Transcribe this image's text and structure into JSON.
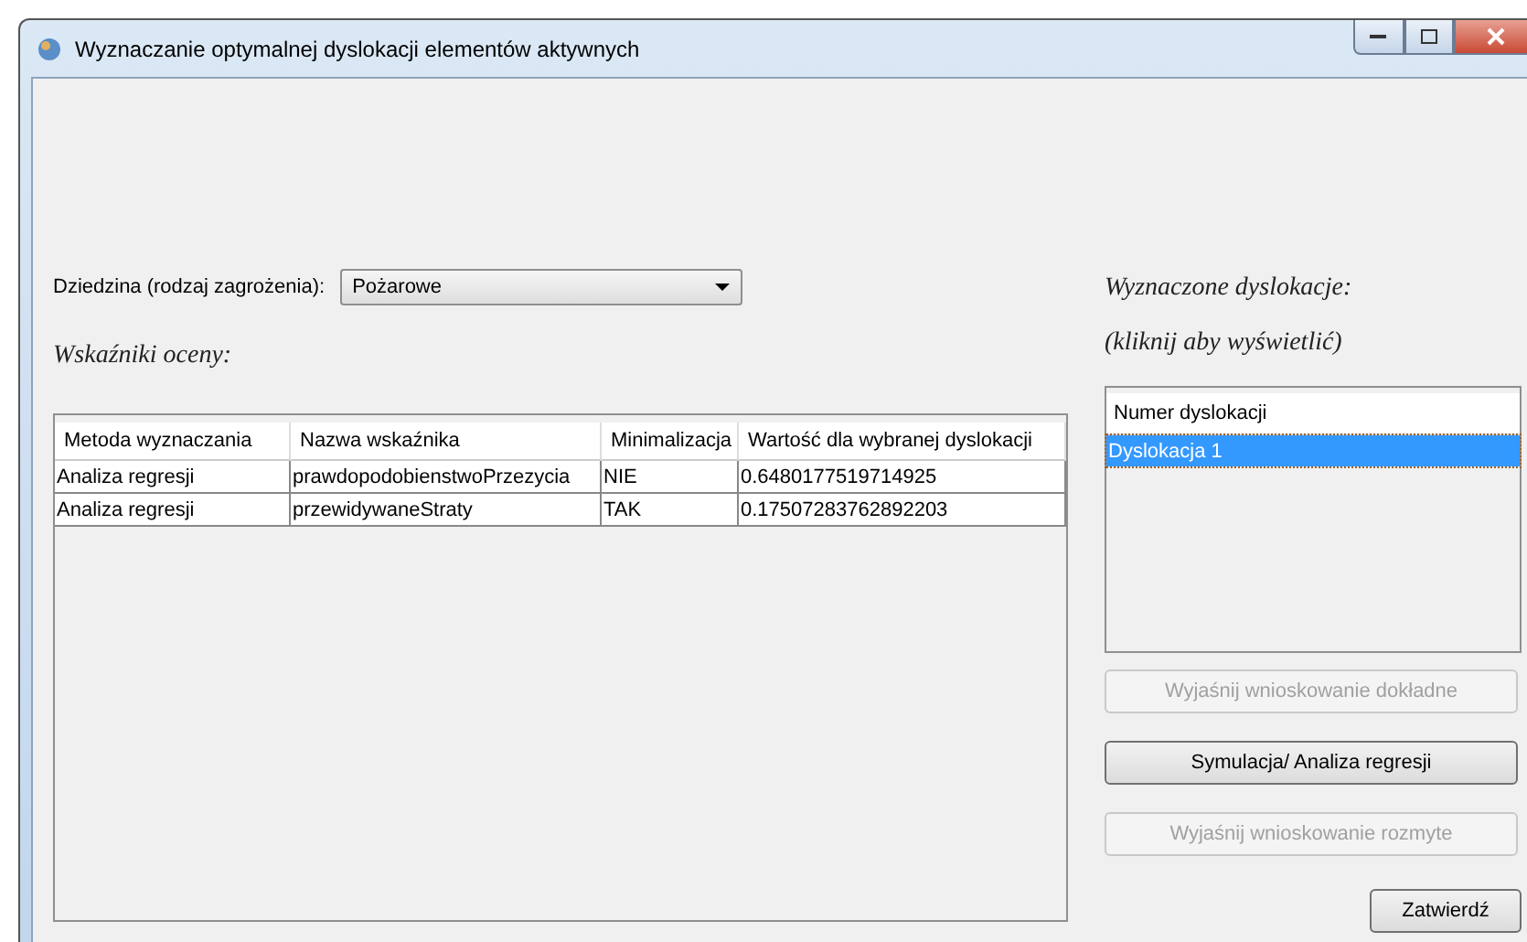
{
  "window": {
    "title": "Wyznaczanie optymalnej dyslokacji elementów aktywnych"
  },
  "domain": {
    "label": "Dziedzina (rodzaj zagrożenia):",
    "value": "Pożarowe"
  },
  "indicators": {
    "heading": "Wskaźniki oceny:",
    "columns": [
      "Metoda wyznaczania",
      "Nazwa wskaźnika",
      "Minimalizacja",
      "Wartość dla wybranej dyslokacji"
    ],
    "rows": [
      {
        "cells": [
          "Analiza regresji",
          "prawdopodobienstwoPrzezycia",
          "NIE",
          "0.6480177519714925"
        ]
      },
      {
        "cells": [
          "Analiza regresji",
          "przewidywaneStraty",
          "TAK",
          "0.17507283762892203"
        ]
      }
    ]
  },
  "dislocations": {
    "heading": "Wyznaczone dyslokacje:",
    "hint": "(kliknij aby wyświetlić)",
    "column": "Numer dyslokacji",
    "items": [
      {
        "label": "Dyslokacja 1",
        "selected": true
      }
    ]
  },
  "actions": [
    {
      "label": "Wyjaśnij wnioskowanie dokładne",
      "disabled": true
    },
    {
      "label": "Symulacja/ Analiza regresji",
      "disabled": false
    },
    {
      "label": "Wyjaśnij wnioskowanie rozmyte",
      "disabled": true
    }
  ],
  "confirm": {
    "label": "Zatwierdź"
  }
}
